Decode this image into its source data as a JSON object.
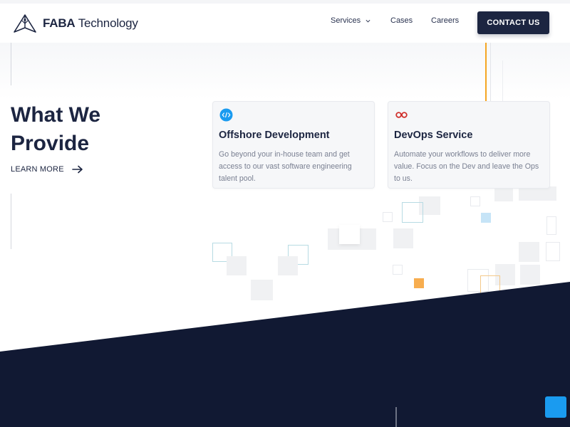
{
  "header": {
    "logo": {
      "brand_bold": "FABA",
      "brand_rest": " Technology",
      "icon": "faba-logo-icon"
    },
    "nav": [
      {
        "label": "Services",
        "icon": "chevron-down-icon"
      },
      {
        "label": "Cases"
      },
      {
        "label": "Careers"
      }
    ],
    "cta_label": "CONTACT US"
  },
  "hero": {
    "title_line1": "What We",
    "title_line2": "Provide",
    "learn_more": "LEARN MORE",
    "learn_more_icon": "arrow-right-icon"
  },
  "cards": [
    {
      "icon": "code-icon",
      "title": "Offshore Development",
      "description": "Go beyond your in-house team and get access to our vast software engineering talent pool."
    },
    {
      "icon": "infinity-icon",
      "title": "DevOps Service",
      "description": "Automate your workflows to deliver more value. Focus on the Dev and leave the Ops to us."
    }
  ],
  "chat_widget": {
    "icon": "chat-icon"
  },
  "colors": {
    "navy": "#1c2541",
    "accent_blue": "#1a9bf0",
    "accent_orange": "#f5a623",
    "devops_red": "#d0312d",
    "text_muted": "#7a8092"
  }
}
